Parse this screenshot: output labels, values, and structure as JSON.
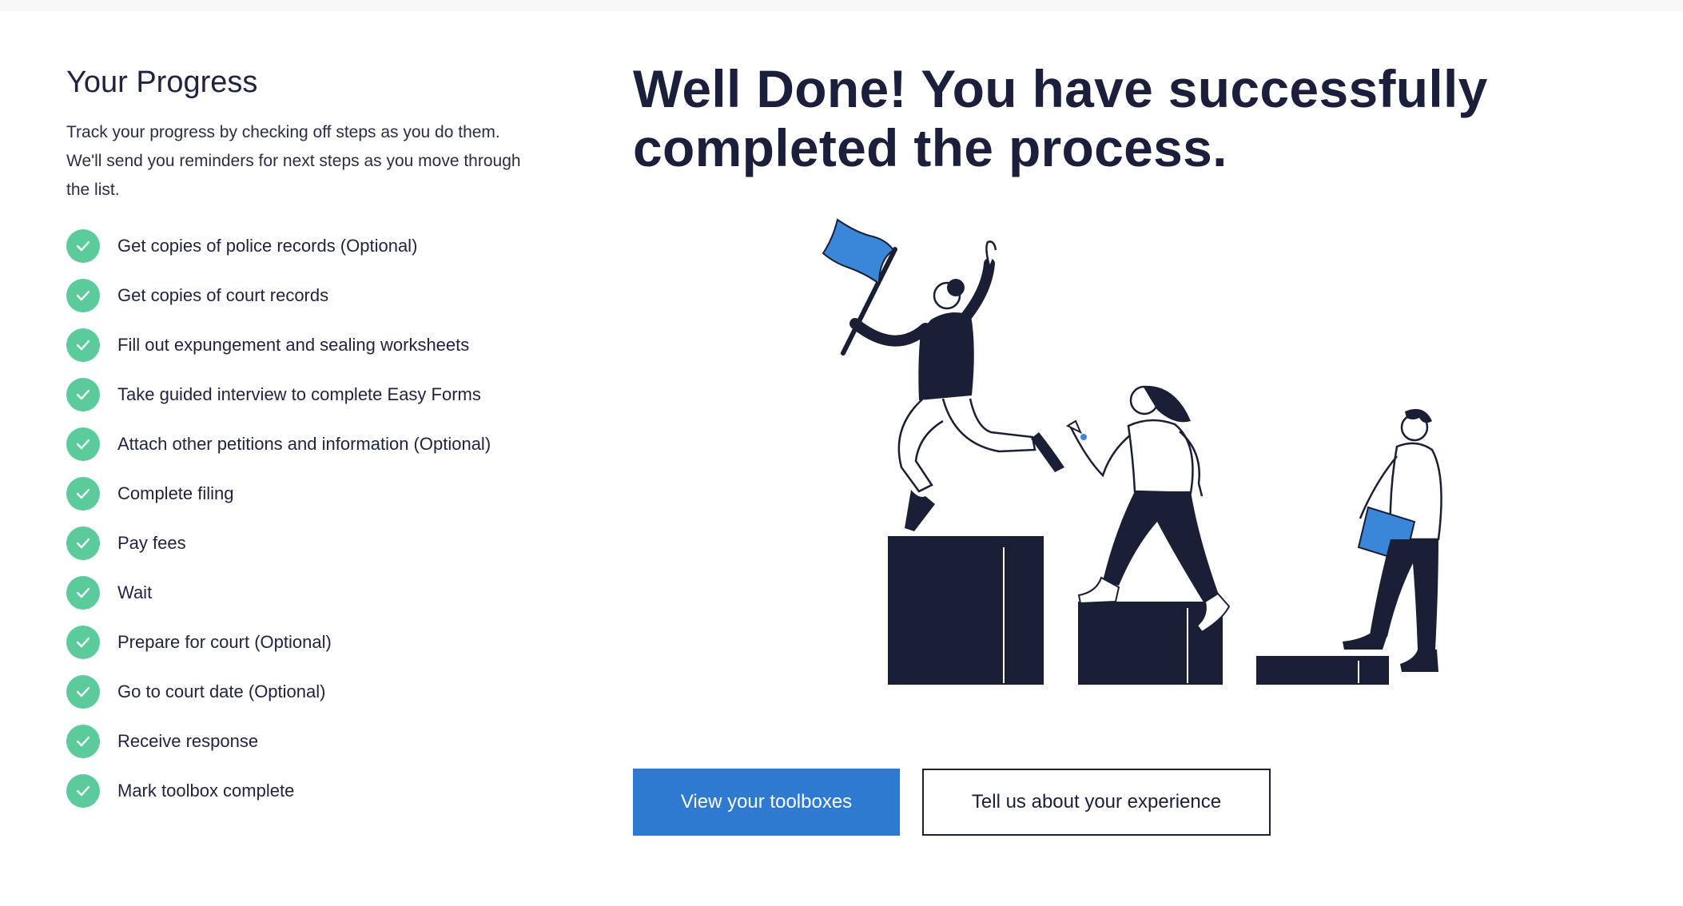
{
  "progress": {
    "title": "Your Progress",
    "description": "Track your progress by checking off steps as you do them. We'll send you reminders for next steps as you move through the list.",
    "check_color": "#5ccb9b",
    "steps": [
      {
        "label": "Get copies of police records (Optional)",
        "completed": true
      },
      {
        "label": "Get copies of court records",
        "completed": true
      },
      {
        "label": "Fill out expungement and sealing worksheets",
        "completed": true
      },
      {
        "label": "Take guided interview to complete Easy Forms",
        "completed": true
      },
      {
        "label": "Attach other petitions and information (Optional)",
        "completed": true
      },
      {
        "label": "Complete filing",
        "completed": true
      },
      {
        "label": "Pay fees",
        "completed": true
      },
      {
        "label": "Wait",
        "completed": true
      },
      {
        "label": "Prepare for court (Optional)",
        "completed": true
      },
      {
        "label": "Go to court date (Optional)",
        "completed": true
      },
      {
        "label": "Receive response",
        "completed": true
      },
      {
        "label": "Mark toolbox complete",
        "completed": true
      }
    ]
  },
  "main": {
    "headline": "Well Done! You have successfully completed the process.",
    "illustration": "people-climbing-steps-illustration"
  },
  "actions": {
    "primary_label": "View your toolboxes",
    "secondary_label": "Tell us about your experience",
    "primary_color": "#2f7ad1"
  }
}
